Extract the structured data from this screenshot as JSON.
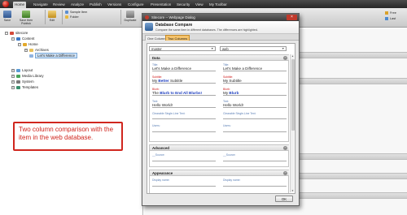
{
  "ribbon": {
    "tabs": [
      "Home",
      "Navigate",
      "Review",
      "Analyze",
      "Publish",
      "Versions",
      "Configure",
      "Presentation",
      "Security",
      "View",
      "My Toolbar"
    ],
    "active_tab": "Home",
    "buttons": {
      "save": "Save",
      "save_and_publish": "Save then Publish",
      "edit": "Edit",
      "duplicate": "Duplicate"
    },
    "insert_items": [
      "Sample Item",
      "Folder"
    ],
    "right_items": [
      "Free",
      "Last"
    ]
  },
  "tree": {
    "items": [
      {
        "label": "sitecore",
        "icon": "sitecore-icon"
      },
      {
        "label": "Content",
        "icon": "content-icon"
      },
      {
        "label": "Home",
        "icon": "home-icon"
      },
      {
        "label": "Archives",
        "icon": "folder-icon"
      },
      {
        "label": "Let's Make a Difference",
        "icon": "document-icon"
      },
      {
        "label": "Layout",
        "icon": "layout-icon"
      },
      {
        "label": "Media Library",
        "icon": "media-icon"
      },
      {
        "label": "System",
        "icon": "system-icon"
      },
      {
        "label": "Templates",
        "icon": "templates-icon"
      }
    ]
  },
  "dialog": {
    "window_title": "Sitecore -- Webpage Dialog",
    "title": "Database Compare",
    "subtitle": "Compare the same item in different databases. The differences are highlighted.",
    "tabs": [
      "One Column",
      "Two Columns"
    ],
    "active_tab": "Two Columns",
    "left_db": "master",
    "right_db": "web",
    "sections": [
      {
        "name": "Data",
        "fields": [
          {
            "label": "Title:",
            "left": "Let's Make a Difference",
            "right": "Let's Make a Difference",
            "different": false
          },
          {
            "label": "Subtitle:",
            "left_pre": "My ",
            "left_bold": "Better",
            "left_post": " Subtitle",
            "right": "My Subtitle",
            "different": true
          },
          {
            "label": "Blurb:",
            "left_pre": "The ",
            "left_bold": "Blurb to End All Blurbs!",
            "left_post": "",
            "right_pre": "My ",
            "right_bold": "Blurb",
            "right_post": "",
            "different": true
          },
          {
            "label": "Text:",
            "left": "Hello World!",
            "right": "Hello World!",
            "different": false
          },
          {
            "label": "Clearable Single-Line Text:",
            "left": "",
            "right": "",
            "different": false
          },
          {
            "label": "Users:",
            "left": "",
            "right": "",
            "different": false
          }
        ]
      },
      {
        "name": "Advanced",
        "fields": [
          {
            "label": "__Source:",
            "left": "",
            "right": "",
            "different": false
          }
        ]
      },
      {
        "name": "Appearance",
        "fields": [
          {
            "label": "Display name:",
            "left": "",
            "right": "",
            "different": false
          }
        ]
      }
    ],
    "ok_label": "OK"
  },
  "annotation": {
    "text": "Two column comparison with the item in the web database."
  },
  "colors": {
    "accent_red": "#d0261e",
    "diff_label": "#d02020",
    "tab_active": "#f5c36b",
    "title_bar": "#3b3b3b"
  }
}
